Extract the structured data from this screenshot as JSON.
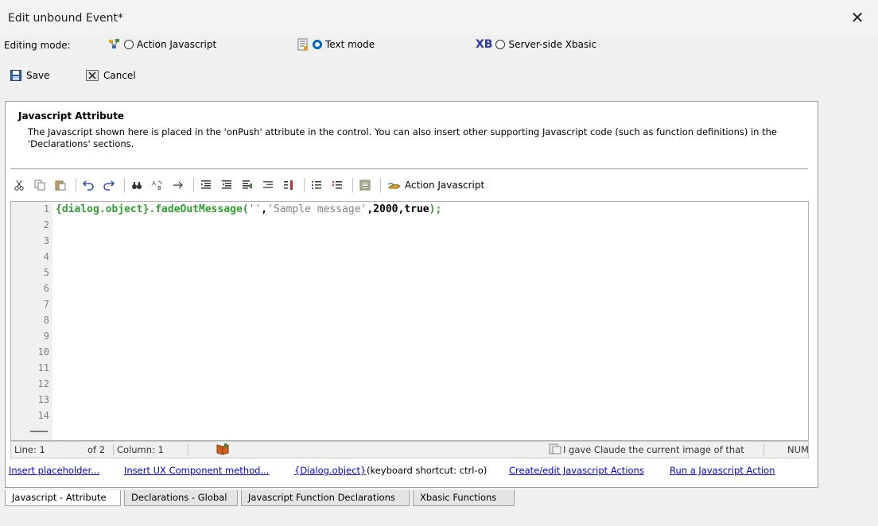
{
  "window": {
    "title": "Edit unbound Event*",
    "close_glyph": "✕"
  },
  "editing_mode": {
    "label": "Editing mode:",
    "options": [
      {
        "label": "Action Javascript",
        "checked": false,
        "icon": "action-js-icon"
      },
      {
        "label": "Text mode",
        "checked": true,
        "icon": "text-mode-icon"
      },
      {
        "label": "Server-side Xbasic",
        "checked": false,
        "icon_text": "XB"
      }
    ]
  },
  "buttons": {
    "save": "Save",
    "cancel": "Cancel"
  },
  "panel": {
    "title": "Javascript Attribute",
    "description": "The Javascript shown here is placed in the 'onPush' attribute in the control. You can also insert other supporting Javascript code (such as function definitions) in the 'Declarations' sections."
  },
  "toolbar": {
    "action_javascript": "Action Javascript"
  },
  "editor": {
    "line_numbers": [
      "1",
      "2",
      "3",
      "4",
      "5",
      "6",
      "7",
      "8",
      "9",
      "10",
      "11",
      "12",
      "13",
      "14"
    ],
    "code": {
      "part1": "{dialog.object}.fadeOutMessage(",
      "part2": "''",
      "part3": ",",
      "part4": "'Sample message'",
      "part5": ",2000,true",
      "part6": ");"
    }
  },
  "status_bar": {
    "line": "Line: 1",
    "of": "of 2",
    "column": "Column: 1",
    "message": "I gave Claude the current image of that",
    "num": "NUM"
  },
  "links": {
    "insert_placeholder": "Insert placeholder...",
    "insert_ux": "Insert UX Component method...",
    "dialog_object": "{Dialog.object}",
    "shortcut": "(keyboard shortcut: ctrl-o)",
    "create_edit": "Create/edit Javascript Actions",
    "run_action": "Run a Javascript Action"
  },
  "tabs": [
    {
      "label": "Javascript - Attribute",
      "active": true
    },
    {
      "label": "Declarations - Global",
      "active": false
    },
    {
      "label": "Javascript Function Declarations",
      "active": false
    },
    {
      "label": "Xbasic Functions",
      "active": false
    }
  ]
}
